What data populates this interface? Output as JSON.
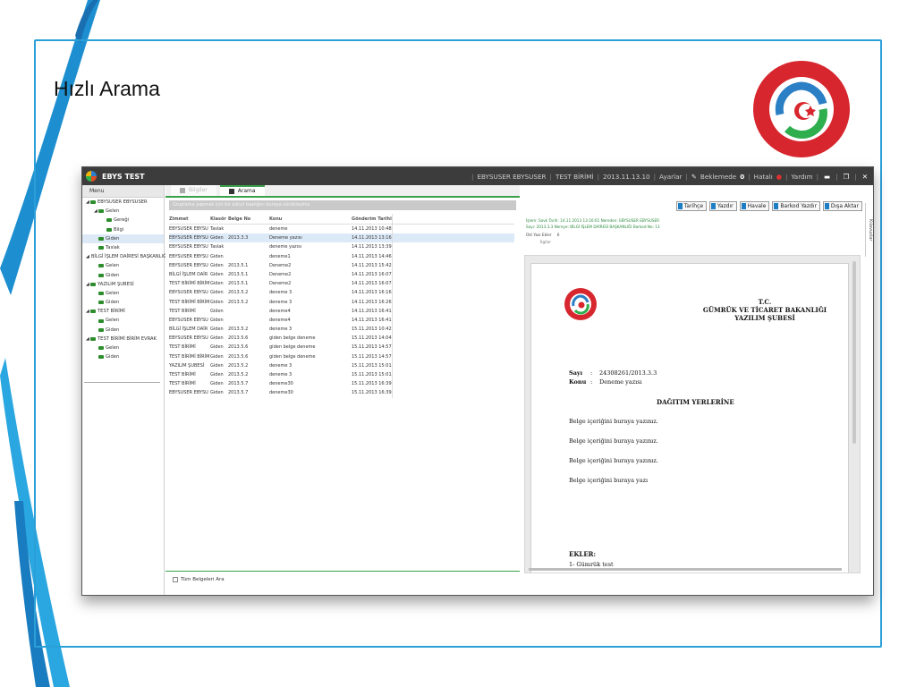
{
  "slide": {
    "title": "Hızlı Arama",
    "accent_color": "#2a9fd8"
  },
  "app": {
    "name": "EBYS TEST",
    "status": {
      "user": "EBYSUSER EBYSUSER",
      "unit": "TEST BİRİMİ",
      "version": "2013.11.13.10",
      "settings": "Ayarlar",
      "pending_label": "Beklemede",
      "pending_count": "0",
      "errors_label": "Hatalı",
      "help": "Yardım"
    }
  },
  "sidebar": {
    "header": "Menu",
    "items": [
      {
        "label": "EBYSUSER EBYSUSER",
        "arrow": "◢",
        "level": 0
      },
      {
        "label": "Gelen",
        "arrow": "◢",
        "level": 1
      },
      {
        "label": "Gereği",
        "arrow": "",
        "level": 2
      },
      {
        "label": "Bilgi",
        "arrow": "",
        "level": 2
      },
      {
        "label": "Giden",
        "arrow": "",
        "level": 1,
        "selected": true
      },
      {
        "label": "Taslak",
        "arrow": "",
        "level": 1
      },
      {
        "label": "BİLGİ İŞLEM DAİRESİ BAŞKANLIĞI",
        "arrow": "◢",
        "level": 0
      },
      {
        "label": "Gelen",
        "arrow": "",
        "level": 1
      },
      {
        "label": "Giden",
        "arrow": "",
        "level": 1
      },
      {
        "label": "YAZILIM ŞUBESİ",
        "arrow": "◢",
        "level": 0
      },
      {
        "label": "Gelen",
        "arrow": "",
        "level": 1
      },
      {
        "label": "Giden",
        "arrow": "",
        "level": 1
      },
      {
        "label": "TEST BİRİMİ",
        "arrow": "◢",
        "level": 0
      },
      {
        "label": "Gelen",
        "arrow": "",
        "level": 1
      },
      {
        "label": "Giden",
        "arrow": "",
        "level": 1
      },
      {
        "label": "TEST BİRİMİ BİRİM EVRAK",
        "arrow": "◢",
        "level": 0
      },
      {
        "label": "Gelen",
        "arrow": "",
        "level": 1
      },
      {
        "label": "Giden",
        "arrow": "",
        "level": 1
      }
    ]
  },
  "tabs": [
    {
      "label": "Bilgiler",
      "active": false
    },
    {
      "label": "Arama",
      "active": true
    }
  ],
  "grid": {
    "group_hint": "Gruplama yapmak için bir sütun başlığını buraya sürükleyiniz",
    "columns": [
      "Zimmet",
      "Klasör",
      "Belge No",
      "Konu",
      "Gönderim Tarihi"
    ],
    "rows": [
      [
        "EBYSUSER EBYSU",
        "Taslak",
        "",
        "deneme",
        "14.11.2013 10:48:"
      ],
      [
        "EBYSUSER EBYSU",
        "Giden",
        "2013.3.3",
        "Deneme yazısı",
        "14.11.2013 13:16:"
      ],
      [
        "EBYSUSER EBYSU",
        "Taslak",
        "",
        "deneme yazısı",
        "14.11.2013 13:39:"
      ],
      [
        "EBYSUSER EBYSU",
        "Giden",
        "",
        "deneme1",
        "14.11.2013 14:46:"
      ],
      [
        "EBYSUSER EBYSU",
        "Giden",
        "2013.5.1",
        "Deneme2",
        "14.11.2013 15:42:"
      ],
      [
        "BİLGİ İŞLEM DAİR",
        "Giden",
        "2013.5.1",
        "Deneme2",
        "14.11.2013 16:07:"
      ],
      [
        "TEST BİRİMİ BİRİM",
        "Giden",
        "2013.5.1",
        "Deneme2",
        "14.11.2013 16:07:"
      ],
      [
        "EBYSUSER EBYSU",
        "Giden",
        "2013.5.2",
        "deneme 3",
        "14.11.2013 16:16:"
      ],
      [
        "TEST BİRİMİ BİRİM",
        "Giden",
        "2013.5.2",
        "deneme 3",
        "14.11.2013 16:26:"
      ],
      [
        "TEST BİRİMİ",
        "Giden",
        "",
        "deneme4",
        "14.11.2013 16:41:"
      ],
      [
        "EBYSUSER EBYSU",
        "Giden",
        "",
        "deneme4",
        "14.11.2013 16:41:"
      ],
      [
        "BİLGİ İŞLEM DAİR",
        "Giden",
        "2013.5.2",
        "deneme 3",
        "15.11.2013 10:42:"
      ],
      [
        "EBYSUSER EBYSU",
        "Giden",
        "2013.5.6",
        "giden belge deneme",
        "15.11.2013 14:04:"
      ],
      [
        "TEST BİRİMİ",
        "Giden",
        "2013.5.6",
        "giden belge deneme",
        "15.11.2013 14:57:"
      ],
      [
        "TEST BİRİMİ BİRİM",
        "Giden",
        "2013.5.6",
        "giden belge deneme",
        "15.11.2013 14:57:"
      ],
      [
        "YAZILIM ŞUBESİ",
        "Giden",
        "2013.5.2",
        "deneme 3",
        "15.11.2013 15:01:"
      ],
      [
        "TEST BİRİMİ",
        "Giden",
        "2013.5.2",
        "deneme 3",
        "15.11.2013 15:01:"
      ],
      [
        "TEST BİRİMİ",
        "Giden",
        "2013.5.7",
        "deneme30",
        "15.11.2013 16:39:"
      ],
      [
        "EBYSUSER EBYSU",
        "Giden",
        "2013.5.7",
        "deneme30",
        "15.11.2013 16:39:"
      ]
    ],
    "selected_row": 1,
    "all_docs_label": "Tüm Belgeleri Ara"
  },
  "actions": [
    "Tarihçe",
    "Yazdır",
    "Havale",
    "Barkod Yazdır",
    "Dışa Aktar"
  ],
  "side_tab": "Kılavuzlar",
  "meta": {
    "line1": "İşlem: Savk    Tarih: 14.11.2013 13:16:01    Nereden: EBYSUSER EBYSUSER",
    "line2": "Sayı: 2013.3.3    Nereye: BİLGİ İŞLEM DAİRESİ BAŞKANLIĞI Barkod No: 13",
    "att1": "Üst Yazı  Ekler",
    "att2": "6",
    "att3": "İlgiler"
  },
  "document": {
    "header": [
      "T.C.",
      "GÜMRÜK VE TİCARET BAKANLIĞI",
      "YAZILIM ŞUBESİ"
    ],
    "sayi_label": "Sayı",
    "sayi_value": "24308261/2013.3.3",
    "konu_label": "Konu",
    "konu_value": "Deneme yazısı",
    "colon": ":",
    "distribution": "DAĞITIM YERLERİNE",
    "body_lines": [
      "Belge içeriğini buraya yazınız.",
      "Belge içeriğini buraya yazınız.",
      "Belge içeriğini buraya yazınız.",
      "Belge içeriğini buraya yazı"
    ],
    "ekler_label": "EKLER:",
    "ekler_first": "1- Gümrük test"
  }
}
